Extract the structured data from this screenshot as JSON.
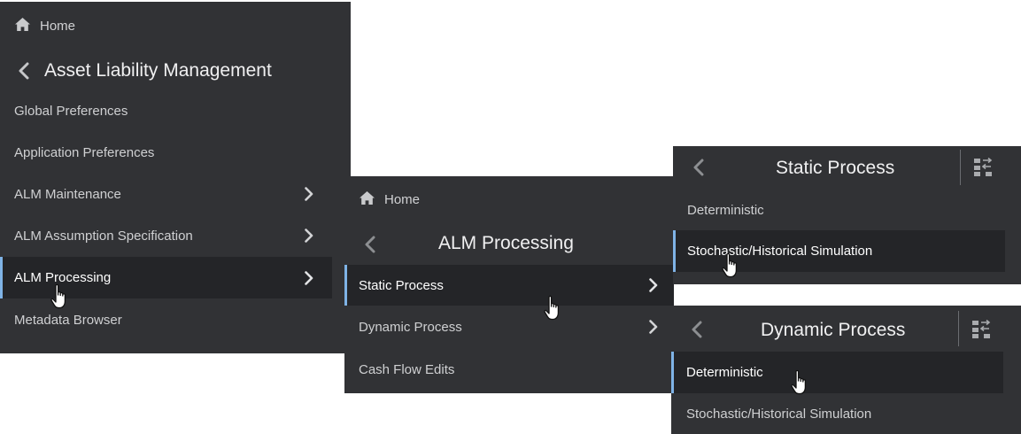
{
  "panel1": {
    "home_label": "Home",
    "title": "Asset Liability Management",
    "items": [
      {
        "label": "Global Preferences"
      },
      {
        "label": "Application Preferences"
      },
      {
        "label": "ALM Maintenance"
      },
      {
        "label": "ALM Assumption Specification"
      },
      {
        "label": "ALM Processing"
      },
      {
        "label": "Metadata Browser"
      }
    ]
  },
  "panel2": {
    "home_label": "Home",
    "title": "ALM Processing",
    "items": [
      {
        "label": "Static Process"
      },
      {
        "label": "Dynamic Process"
      },
      {
        "label": "Cash Flow Edits"
      }
    ]
  },
  "panel3": {
    "title": "Static Process",
    "items": [
      {
        "label": "Deterministic"
      },
      {
        "label": "Stochastic/Historical Simulation"
      }
    ]
  },
  "panel4": {
    "title": "Dynamic Process",
    "items": [
      {
        "label": "Deterministic"
      },
      {
        "label": "Stochastic/Historical Simulation"
      }
    ]
  },
  "colors": {
    "panel_bg": "#313235",
    "selected_bg": "#242528",
    "selected_accent": "#7fb3e6",
    "text": "#cfd0d2"
  },
  "icons": [
    "home-icon",
    "chevron-left-icon",
    "chevron-right-icon",
    "toggle-view-icon",
    "hand-pointer-icon"
  ]
}
